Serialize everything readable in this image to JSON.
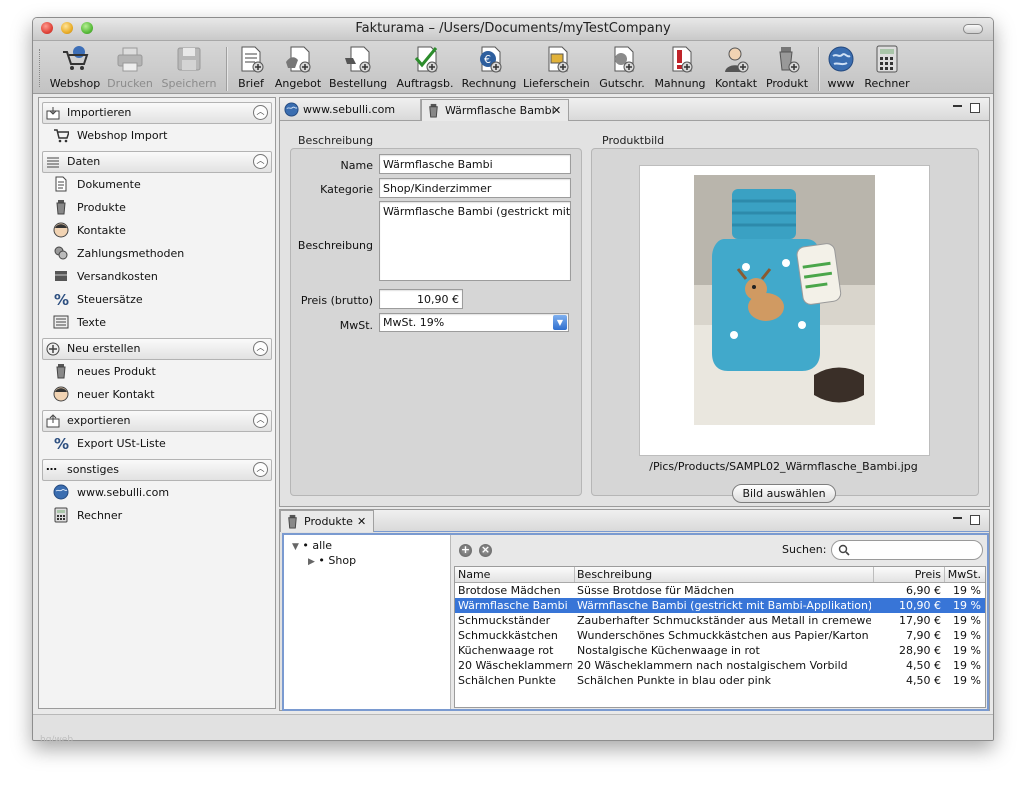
{
  "window": {
    "title": "Fakturama – /Users/Documents/myTestCompany"
  },
  "toolbar": {
    "buttons": [
      {
        "label": "Webshop",
        "icon": "webshop-cart-icon",
        "enabled": true
      },
      {
        "label": "Drucken",
        "icon": "printer-icon",
        "enabled": false
      },
      {
        "label": "Speichern",
        "icon": "save-disk-icon",
        "enabled": false
      },
      {
        "label": "Brief",
        "icon": "letter-icon",
        "enabled": true
      },
      {
        "label": "Angebot",
        "icon": "offer-icon",
        "enabled": true
      },
      {
        "label": "Bestellung",
        "icon": "order-icon",
        "enabled": true
      },
      {
        "label": "Auftragsb.",
        "icon": "confirmation-icon",
        "enabled": true
      },
      {
        "label": "Rechnung",
        "icon": "invoice-icon",
        "enabled": true
      },
      {
        "label": "Lieferschein",
        "icon": "delivery-note-icon",
        "enabled": true
      },
      {
        "label": "Gutschr.",
        "icon": "credit-note-icon",
        "enabled": true
      },
      {
        "label": "Mahnung",
        "icon": "dunning-icon",
        "enabled": true
      },
      {
        "label": "Kontakt",
        "icon": "contact-icon",
        "enabled": true
      },
      {
        "label": "Produkt",
        "icon": "product-icon",
        "enabled": true
      },
      {
        "label": "www",
        "icon": "globe-icon",
        "enabled": true
      },
      {
        "label": "Rechner",
        "icon": "calculator-icon",
        "enabled": true
      }
    ]
  },
  "sidebar": {
    "sections": [
      {
        "title": "Importieren",
        "icon": "import-icon",
        "items": [
          {
            "label": "Webshop Import",
            "icon": "webshop-cart-icon"
          }
        ]
      },
      {
        "title": "Daten",
        "icon": "data-icon",
        "items": [
          {
            "label": "Dokumente",
            "icon": "document-icon"
          },
          {
            "label": "Produkte",
            "icon": "product-icon"
          },
          {
            "label": "Kontakte",
            "icon": "contact-icon"
          },
          {
            "label": "Zahlungsmethoden",
            "icon": "payment-icon"
          },
          {
            "label": "Versandkosten",
            "icon": "shipping-icon"
          },
          {
            "label": "Steuersätze",
            "icon": "percent-icon"
          },
          {
            "label": "Texte",
            "icon": "text-icon"
          }
        ]
      },
      {
        "title": "Neu erstellen",
        "icon": "new-icon",
        "items": [
          {
            "label": "neues Produkt",
            "icon": "product-icon"
          },
          {
            "label": "neuer Kontakt",
            "icon": "contact-icon"
          }
        ]
      },
      {
        "title": "exportieren",
        "icon": "export-icon",
        "items": [
          {
            "label": "Export USt-Liste",
            "icon": "percent-icon"
          }
        ]
      },
      {
        "title": "sonstiges",
        "icon": "ellipsis-icon",
        "items": [
          {
            "label": "www.sebulli.com",
            "icon": "globe-icon"
          },
          {
            "label": "Rechner",
            "icon": "calculator-icon"
          }
        ]
      }
    ]
  },
  "editor": {
    "tabs": [
      {
        "label": "www.sebulli.com",
        "icon": "globe-icon"
      },
      {
        "label": "Wärmflasche Bambi",
        "icon": "product-icon",
        "closable": true
      }
    ],
    "description_group": "Beschreibung",
    "image_group": "Produktbild",
    "labels": {
      "name": "Name",
      "category": "Kategorie",
      "description": "Beschreibung",
      "price": "Preis (brutto)",
      "vat": "MwSt."
    },
    "values": {
      "name": "Wärmflasche Bambi",
      "category": "Shop/Kinderzimmer",
      "description": "Wärmflasche Bambi (gestrickt mit Ba",
      "price": "10,90 €",
      "vat": "MwSt. 19%"
    },
    "image_path": "/Pics/Products/SAMPL02_Wärmflasche_Bambi.jpg",
    "choose_image_button": "Bild auswählen"
  },
  "products_panel": {
    "tab_label": "Produkte",
    "tree": {
      "root": "• alle",
      "child": "• Shop"
    },
    "search_label": "Suchen:",
    "columns": [
      "Name",
      "Beschreibung",
      "Preis",
      "MwSt."
    ],
    "rows": [
      {
        "name": "Brotdose Mädchen",
        "desc": "Süsse Brotdose für Mädchen",
        "price": "6,90 €",
        "vat": "19 %"
      },
      {
        "name": "Wärmflasche Bambi",
        "desc": "Wärmflasche Bambi (gestrickt mit Bambi-Applikation)",
        "price": "10,90 €",
        "vat": "19 %"
      },
      {
        "name": "Schmuckständer",
        "desc": "Zauberhafter Schmuckständer aus Metall in cremeweiß",
        "price": "17,90 €",
        "vat": "19 %"
      },
      {
        "name": "Schmuckkästchen",
        "desc": "Wunderschönes Schmuckkästchen aus Papier/Karton",
        "price": "7,90 €",
        "vat": "19 %"
      },
      {
        "name": "Küchenwaage rot",
        "desc": "Nostalgische Küchenwaage in rot",
        "price": "28,90 €",
        "vat": "19 %"
      },
      {
        "name": "20 Wäscheklammern",
        "desc": "20 Wäscheklammern nach nostalgischem Vorbild",
        "price": "4,50 €",
        "vat": "19 %"
      },
      {
        "name": "Schälchen Punkte",
        "desc": "Schälchen Punkte in blau oder pink",
        "price": "4,50 €",
        "vat": "19 %"
      }
    ],
    "selected_row": 1
  },
  "watermark": "hq/web",
  "colors": {
    "selection": "#3875d7",
    "accent_border": "#7a9ad0"
  }
}
